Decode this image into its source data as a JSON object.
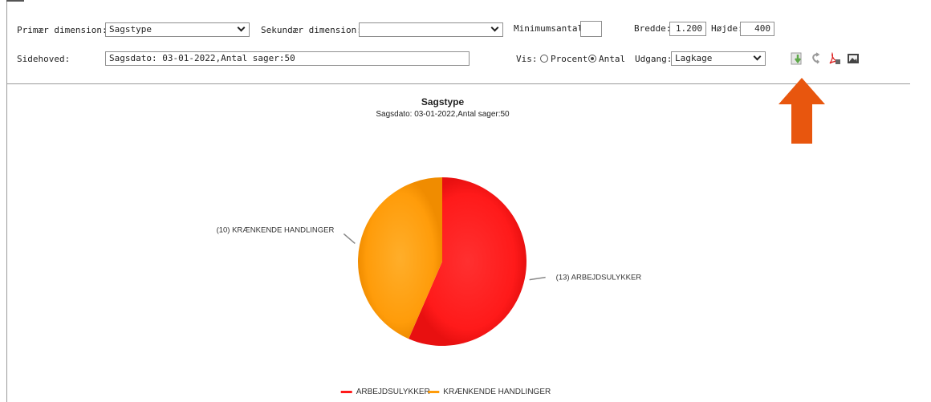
{
  "toolbar": {
    "primary_dimension_label": "Primær dimension:",
    "primary_dimension_value": "Sagstype",
    "secondary_dimension_label": "Sekundær dimension:",
    "secondary_dimension_value": "",
    "min_count_label": "Minimumsantal:",
    "min_count_value": "",
    "width_label": "Bredde:",
    "width_value": "1.200",
    "height_label": "Højde:",
    "height_value": "400",
    "header_label": "Sidehoved:",
    "header_value": "Sagsdato: 03-01-2022,Antal sager:50",
    "show_label": "Vis:",
    "percent_label": "Procent",
    "count_label": "Antal",
    "selected_show": "Antal",
    "output_label": "Udgang:",
    "output_value": "Lagkage",
    "tools": [
      {
        "icon": "download-icon"
      },
      {
        "icon": "refresh-icon"
      },
      {
        "icon": "pdf-icon"
      },
      {
        "icon": "image-icon"
      }
    ]
  },
  "annotation": {
    "arrow_color": "#e8560e"
  },
  "chart_data": {
    "type": "pie",
    "title": "Sagstype",
    "subtitle": "Sagsdato: 03-01-2022,Antal sager:50",
    "slices": [
      {
        "name": "ARBEJDSULYKKER",
        "value": 13,
        "label": "(13) ARBEJDSULYKKER",
        "color": "#ff1a1a"
      },
      {
        "name": "KRÆNKENDE HANDLINGER",
        "value": 10,
        "label": "(10) KRÆNKENDE HANDLINGER",
        "color": "#ff9c0a"
      }
    ],
    "legend": [
      "ARBEJDSULYKKER",
      "KRÆNKENDE HANDLINGER"
    ],
    "legend_position": "bottom"
  }
}
